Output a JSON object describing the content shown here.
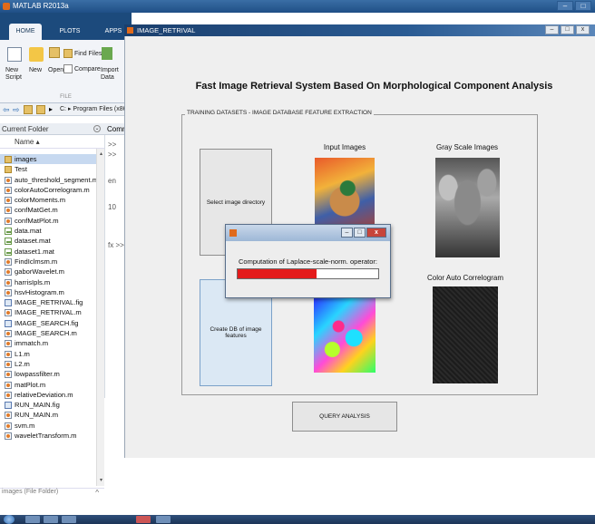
{
  "matlab": {
    "title": "MATLAB R2013a",
    "tabs": [
      "HOME",
      "PLOTS",
      "APPS"
    ],
    "toolbar": {
      "new_script": "New\nScript",
      "new": "New",
      "open": "Open",
      "find_files": "Find Files",
      "compare": "Compare",
      "import_data": "Import\nData",
      "section": "FILE"
    },
    "address": "C: ▸ Program Files (x86",
    "current_folder": {
      "title": "Current Folder",
      "column": "Name ▴",
      "items": [
        {
          "name": "images",
          "type": "folder",
          "selected": true
        },
        {
          "name": "Test",
          "type": "folder"
        },
        {
          "name": "auto_threshold_segment.m",
          "type": "m"
        },
        {
          "name": "colorAutoCorrelogram.m",
          "type": "m"
        },
        {
          "name": "colorMoments.m",
          "type": "m"
        },
        {
          "name": "confMatGet.m",
          "type": "m"
        },
        {
          "name": "confMatPlot.m",
          "type": "m"
        },
        {
          "name": "data.mat",
          "type": "mat"
        },
        {
          "name": "dataset.mat",
          "type": "mat"
        },
        {
          "name": "dataset1.mat",
          "type": "mat"
        },
        {
          "name": "FindIclmsm.m",
          "type": "m"
        },
        {
          "name": "gaborWavelet.m",
          "type": "m"
        },
        {
          "name": "harrisIpls.m",
          "type": "m"
        },
        {
          "name": "hsvHistogram.m",
          "type": "m"
        },
        {
          "name": "IMAGE_RETRIVAL.fig",
          "type": "fig"
        },
        {
          "name": "IMAGE_RETRIVAL.m",
          "type": "m"
        },
        {
          "name": "IMAGE_SEARCH.fig",
          "type": "fig"
        },
        {
          "name": "IMAGE_SEARCH.m",
          "type": "m"
        },
        {
          "name": "immatch.m",
          "type": "m"
        },
        {
          "name": "L1.m",
          "type": "m"
        },
        {
          "name": "L2.m",
          "type": "m"
        },
        {
          "name": "lowpassfilter.m",
          "type": "m"
        },
        {
          "name": "matPlot.m",
          "type": "m"
        },
        {
          "name": "relativeDeviation.m",
          "type": "m"
        },
        {
          "name": "RUN_MAIN.fig",
          "type": "fig"
        },
        {
          "name": "RUN_MAIN.m",
          "type": "m"
        },
        {
          "name": "svm.m",
          "type": "m"
        },
        {
          "name": "waveletTransform.m",
          "type": "m"
        }
      ],
      "footer": "images (File Folder)"
    },
    "command_window": {
      "title": "Comm",
      "lines": [
        ">>",
        ">>",
        "en",
        "10"
      ],
      "prompt": "fx >>"
    }
  },
  "figure": {
    "title": "IMAGE_RETRIVAL",
    "heading": "Fast Image Retrieval System Based On Morphological Component Analysis",
    "group_label": "TRAINING DATASETS - IMAGE DATABASE FEATURE EXTRACTION",
    "select_button": "Select image directory",
    "create_button": "Create DB of image features",
    "query_button": "QUERY ANALYSIS",
    "input_label": "Input Images",
    "gray_label": "Gray Scale Images",
    "corr_label": "Color Auto Correlogram"
  },
  "dialog": {
    "message": "Computation of Laplace-scale-norm. operator:",
    "progress": 0.56,
    "progress_color": "#e41b1b"
  }
}
